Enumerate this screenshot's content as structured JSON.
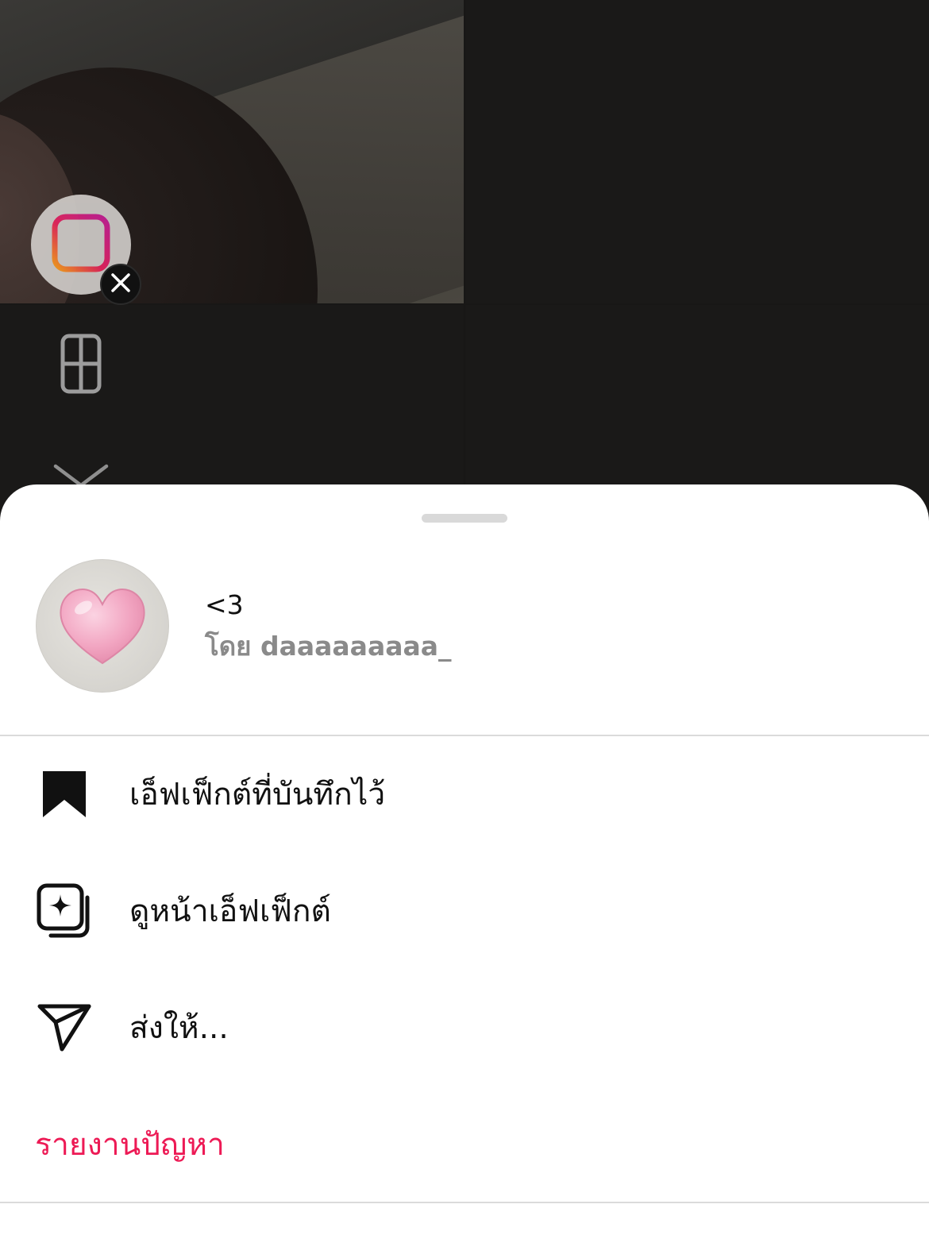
{
  "camera": {
    "effect_icon": "layout-effect-icon",
    "remove_icon": "close-icon",
    "layout_icon": "grid-layout-icon",
    "collapse_icon": "chevron-down-icon"
  },
  "sheet": {
    "effect": {
      "name": "<3",
      "author": "โดย daaaaaaaaa_",
      "avatar_icon": "pink-heart-icon"
    },
    "menu": [
      {
        "label": "เอ็ฟเฟ็กต์ที่บันทึกไว้",
        "icon": "bookmark-icon"
      },
      {
        "label": "ดูหน้าเอ็ฟเฟ็กต์",
        "icon": "effects-page-icon"
      },
      {
        "label": "ส่งให้...",
        "icon": "send-icon"
      }
    ],
    "report": {
      "label": "รายงานปัญหา",
      "color": "#ed1a55"
    }
  }
}
